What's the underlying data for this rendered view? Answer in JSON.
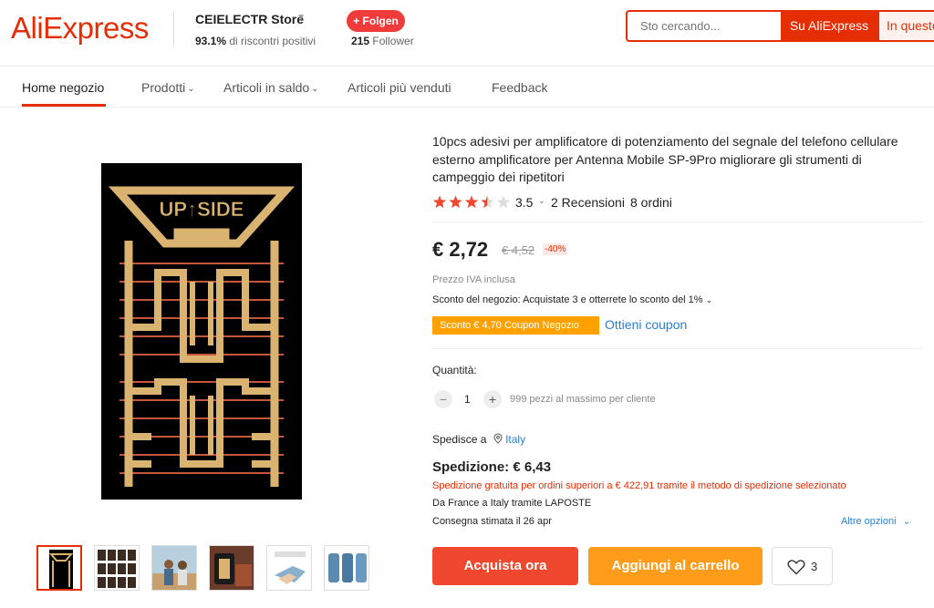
{
  "header": {
    "logo": "AliExpress",
    "store_name": "CEIELECTR Store",
    "store_rating_value": "93.1%",
    "store_rating_text": " di riscontri positivi",
    "follow_label": "+ Folgen",
    "followers_count": "215",
    "followers_text": " Follower",
    "search_placeholder": "Sto cercando...",
    "search_site_button": "Su AliExpress",
    "search_store_button": "In questo negozio"
  },
  "nav": {
    "items": [
      {
        "label": "Home negozio",
        "active": true,
        "dropdown": false
      },
      {
        "label": "Prodotti",
        "dropdown": true
      },
      {
        "label": "Articoli in saldo",
        "dropdown": true
      },
      {
        "label": "Articoli più venduti",
        "dropdown": false
      },
      {
        "label": "Feedback",
        "dropdown": false
      }
    ]
  },
  "gallery": {
    "main_image_text": "UP↑SIDE",
    "thumbnails": [
      "antenna-sticker",
      "sticker-grid",
      "people-outdoor",
      "phone-with-sticker",
      "hand-holding-sticker",
      "phone-cases"
    ]
  },
  "product": {
    "title": "10pcs adesivi per amplificatore di potenziamento del segnale del telefono cellulare esterno amplificatore per Antenna Mobile SP-9Pro migliorare gli strumenti di campeggio dei ripetitori",
    "rating": "3.5",
    "rating_fraction": 0.7,
    "reviews": "2 Recensioni",
    "orders": "8 ordini",
    "price": "€ 2,72",
    "old_price": "€ 4,52",
    "discount": "-40%",
    "vat_note": "Prezzo IVA inclusa",
    "store_discount": "Sconto del negozio: Acquistate 3 e otterrete lo sconto del 1%",
    "coupon_label": "Sconto € 4,70 Coupon Negozio",
    "coupon_link": "Ottieni coupon",
    "quantity_label": "Quantità:",
    "quantity_value": "1",
    "quantity_max": "999 pezzi al massimo per cliente",
    "ship_to_label": "Spedisce a",
    "ship_to_country": "Italy",
    "shipping_title": "Spedizione: € 6,43",
    "free_shipping_note": "Spedizione gratuita per ordini superiori a € 422,91 tramite il metodo di spedizione selezionato",
    "ship_from": "Da France a Italy tramite LAPOSTE",
    "delivery_prefix": "Consegna stimata il ",
    "delivery_date": "26 apr",
    "more_options": "Altre opzioni",
    "buy_now": "Acquista ora",
    "add_to_cart": "Aggiungi al carrello",
    "wishlist_count": "3"
  },
  "colors": {
    "brand": "#e62e04",
    "buy": "#f0482e",
    "cart": "#ff9c1a",
    "coupon": "#ffa200",
    "link": "#2a7fd4",
    "star": "#f0482e"
  }
}
